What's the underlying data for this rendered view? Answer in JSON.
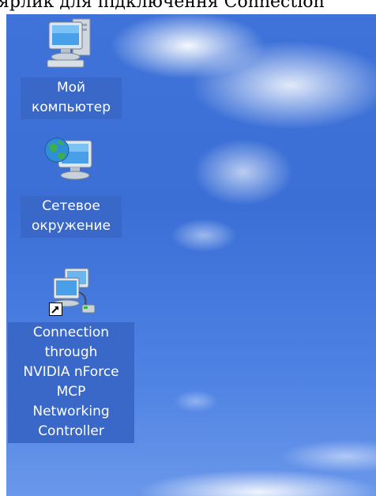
{
  "caption": {
    "text": "ярлик для підключення Connection"
  },
  "desktop": {
    "icons": [
      {
        "id": "my-computer",
        "label_lines": [
          "Мой",
          "компьютер"
        ]
      },
      {
        "id": "network",
        "label_lines": [
          "Сетевое",
          "окружение"
        ]
      },
      {
        "id": "connection",
        "label_lines": [
          "Connection",
          "through",
          "NVIDIA nForce",
          "MCP",
          "Networking",
          "Controller"
        ]
      }
    ]
  },
  "colors": {
    "label_bg": "#3a68c9",
    "wallpaper": "#3f73d9"
  }
}
